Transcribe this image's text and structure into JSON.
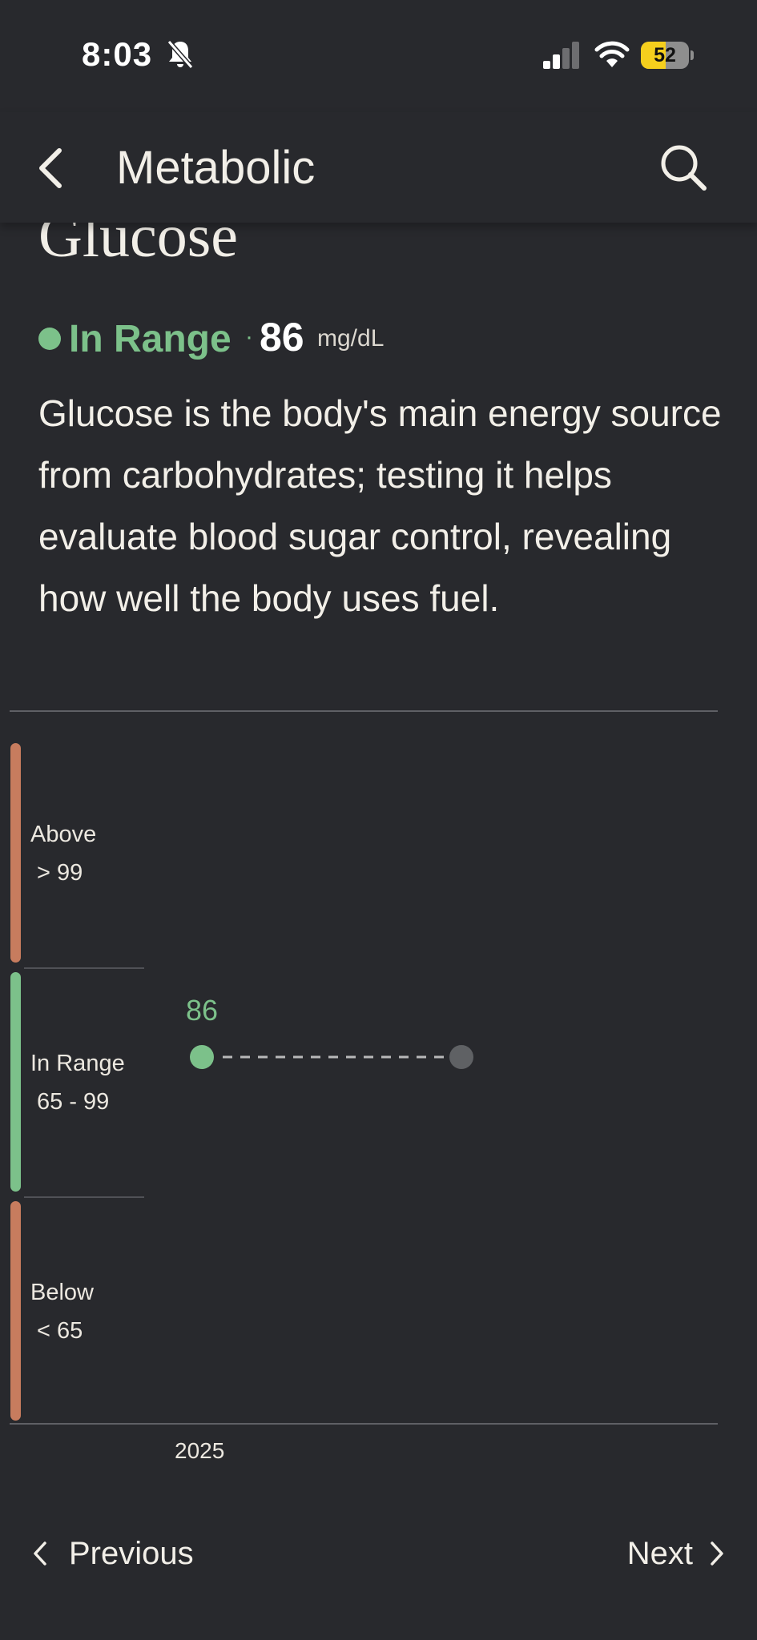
{
  "status_bar": {
    "time": "8:03",
    "battery_percent": "52",
    "battery_level": 0.52,
    "icons": [
      "bell-slash-icon",
      "signal-icon",
      "wifi-icon",
      "battery-icon"
    ]
  },
  "nav": {
    "title": "Metabolic",
    "icons": [
      "chevron-left-icon",
      "search-icon"
    ]
  },
  "page": {
    "title": "Glucose",
    "status": "In Range",
    "separator": "·",
    "value": "86",
    "unit": "mg/dL",
    "description": "Glucose is the body's main energy source from carbohydrates; testing it helps evaluate blood sugar control, revealing how well the body uses fuel."
  },
  "chart_data": {
    "type": "scatter",
    "ranges": [
      {
        "label": "Above",
        "range": "> 99",
        "color": "#c77c5e"
      },
      {
        "label": "In Range",
        "range": "65 - 99",
        "color": "#7cc18a"
      },
      {
        "label": "Below",
        "range": "< 65",
        "color": "#c77c5e"
      }
    ],
    "points": [
      {
        "x": "2025",
        "value": 86,
        "label": "86",
        "color": "#7cc18a"
      }
    ],
    "x_tick_labels": [
      "2025"
    ],
    "colors": {
      "in_range": "#7cc18a",
      "out_of_range": "#c77c5e",
      "future_point": "#5f6164"
    }
  },
  "footer": {
    "previous_label": "Previous",
    "next_label": "Next"
  }
}
